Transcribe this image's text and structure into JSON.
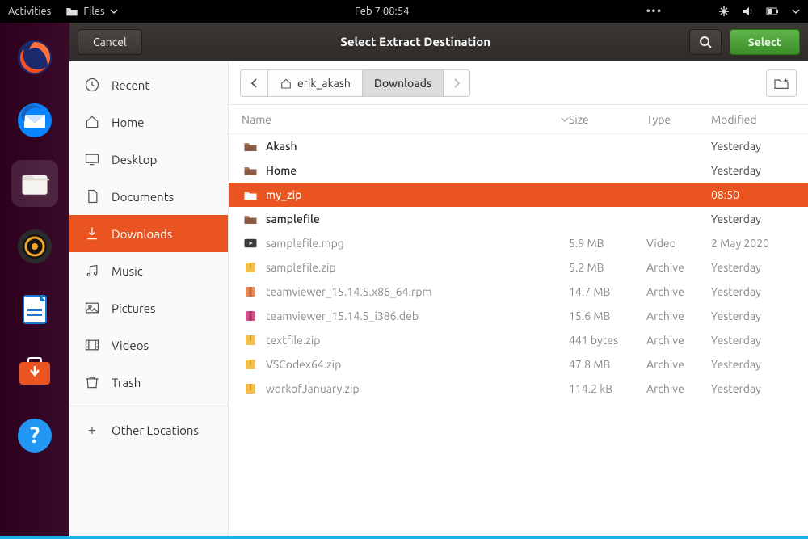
{
  "topbar": {
    "activities": "Activities",
    "files_label": "Files",
    "datetime": "Feb 7  08:54"
  },
  "headerbar": {
    "cancel": "Cancel",
    "title": "Select Extract Destination",
    "select": "Select"
  },
  "sidebar": {
    "items": [
      {
        "label": "Recent"
      },
      {
        "label": "Home"
      },
      {
        "label": "Desktop"
      },
      {
        "label": "Documents"
      },
      {
        "label": "Downloads"
      },
      {
        "label": "Music"
      },
      {
        "label": "Pictures"
      },
      {
        "label": "Videos"
      },
      {
        "label": "Trash"
      },
      {
        "label": "Other Locations"
      }
    ]
  },
  "pathbar": {
    "home_seg": "erik_akash",
    "current_seg": "Downloads"
  },
  "columns": {
    "name": "Name",
    "size": "Size",
    "type": "Type",
    "modified": "Modified"
  },
  "files": [
    {
      "name": "Akash",
      "size": "",
      "type": "",
      "modified": "Yesterday",
      "kind": "folder",
      "selected": false,
      "dim": false
    },
    {
      "name": "Home",
      "size": "",
      "type": "",
      "modified": "Yesterday",
      "kind": "folder",
      "selected": false,
      "dim": false
    },
    {
      "name": "my_zip",
      "size": "",
      "type": "",
      "modified": "08:50",
      "kind": "folder",
      "selected": true,
      "dim": false
    },
    {
      "name": "samplefile",
      "size": "",
      "type": "",
      "modified": "Yesterday",
      "kind": "folder",
      "selected": false,
      "dim": false
    },
    {
      "name": "samplefile.mpg",
      "size": "5.9 MB",
      "type": "Video",
      "modified": "2 May 2020",
      "kind": "video",
      "selected": false,
      "dim": true
    },
    {
      "name": "samplefile.zip",
      "size": "5.2 MB",
      "type": "Archive",
      "modified": "Yesterday",
      "kind": "archive",
      "selected": false,
      "dim": true
    },
    {
      "name": "teamviewer_15.14.5.x86_64.rpm",
      "size": "14.7 MB",
      "type": "Archive",
      "modified": "Yesterday",
      "kind": "rpm",
      "selected": false,
      "dim": true
    },
    {
      "name": "teamviewer_15.14.5_i386.deb",
      "size": "15.6 MB",
      "type": "Archive",
      "modified": "Yesterday",
      "kind": "deb",
      "selected": false,
      "dim": true
    },
    {
      "name": "textfile.zip",
      "size": "441 bytes",
      "type": "Archive",
      "modified": "Yesterday",
      "kind": "archive",
      "selected": false,
      "dim": true
    },
    {
      "name": "VSCodex64.zip",
      "size": "47.8 MB",
      "type": "Archive",
      "modified": "Yesterday",
      "kind": "archive",
      "selected": false,
      "dim": true
    },
    {
      "name": "workofJanuary.zip",
      "size": "114.2 kB",
      "type": "Archive",
      "modified": "Yesterday",
      "kind": "archive",
      "selected": false,
      "dim": true
    }
  ]
}
